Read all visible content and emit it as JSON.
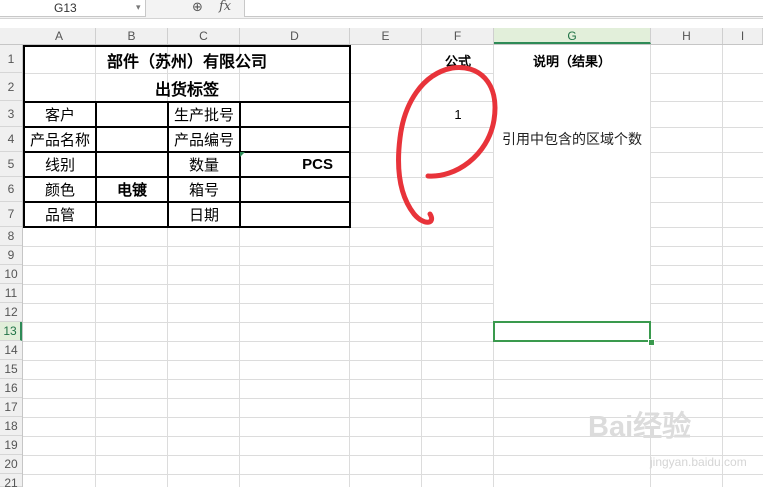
{
  "formula_bar": {
    "name_box": "G13",
    "zoom_icon": "⊕",
    "fx_label": "fx",
    "formula": ""
  },
  "columns": [
    "A",
    "B",
    "C",
    "D",
    "E",
    "F",
    "G",
    "H",
    "I"
  ],
  "selected_column": "G",
  "rows": [
    "1",
    "2",
    "3",
    "4",
    "5",
    "6",
    "7",
    "8",
    "9",
    "10",
    "11",
    "12",
    "13",
    "14",
    "15",
    "16",
    "17",
    "18",
    "19",
    "20",
    "21"
  ],
  "selected_row": "13",
  "table": {
    "company": "部件（苏州）有限公司",
    "label_title": "出货标签",
    "customer": "客户",
    "production_batch": "生产批号",
    "product_name": "产品名称",
    "product_code": "产品编号",
    "wire_type": "线别",
    "quantity": "数量",
    "unit": "PCS",
    "color": "颜色",
    "color_value": "电镀",
    "box_no": "箱号",
    "qc": "品管",
    "date": "日期"
  },
  "f_header": "公式",
  "g_header": "说明（结果）",
  "f_result": "1",
  "g_description": "引用中包含的区域个数",
  "watermark": {
    "brand": "Bai经验",
    "sub": "jingyan.baidu.com"
  },
  "colors": {
    "selection": "#3a9a4e",
    "scribble": "#e8333a"
  }
}
